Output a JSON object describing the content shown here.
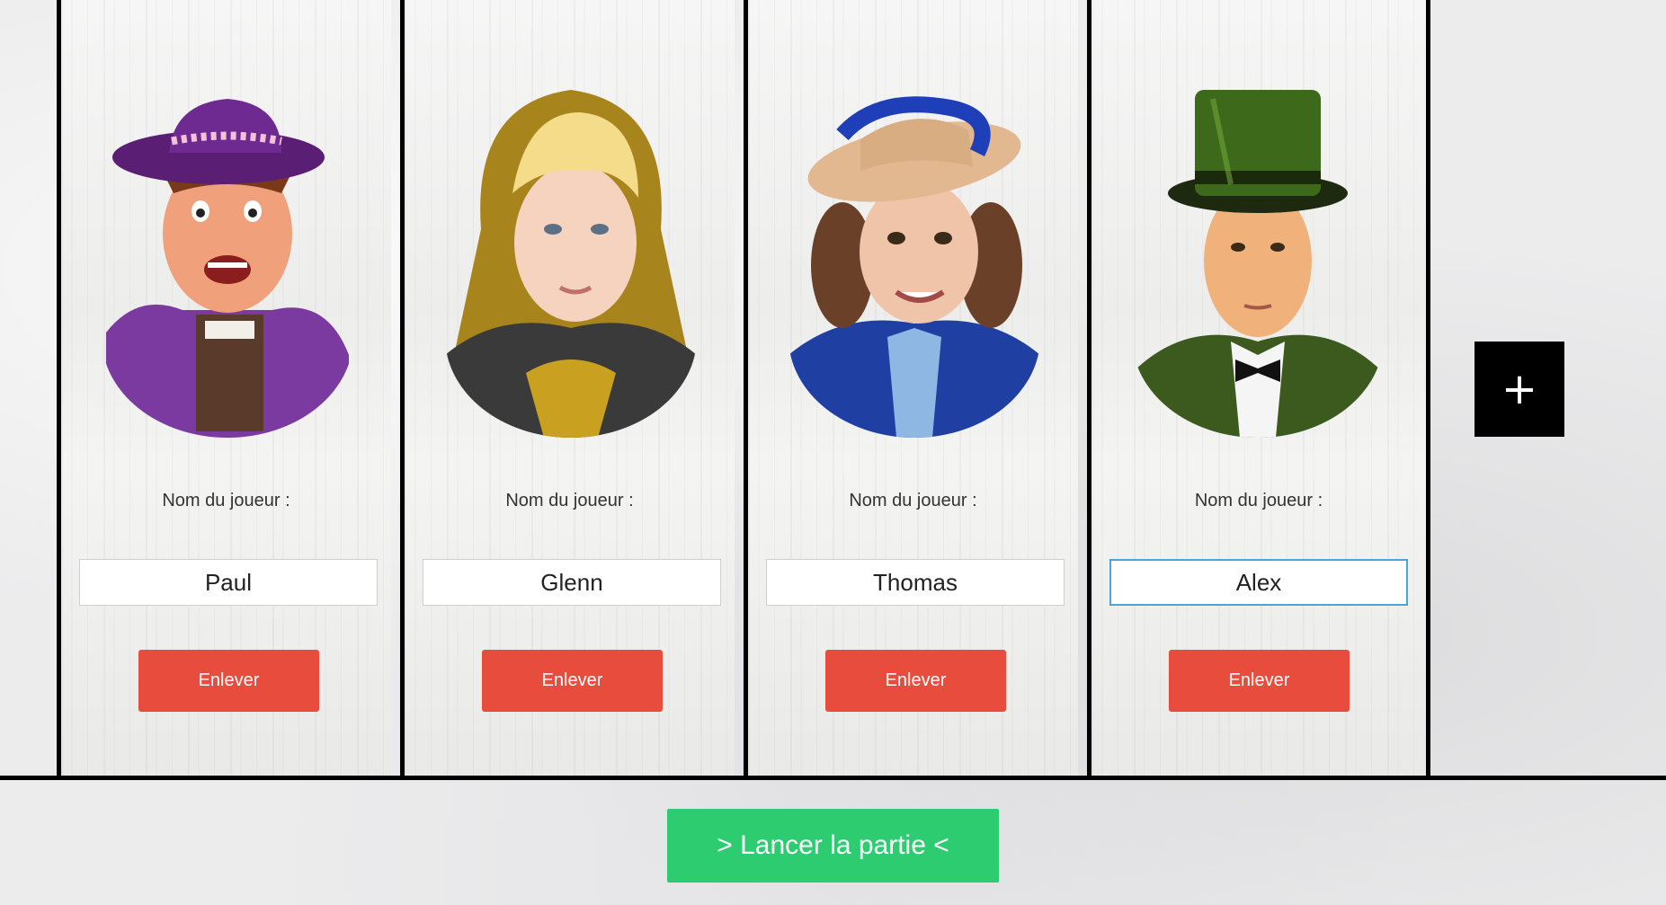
{
  "players": [
    {
      "character": "boy-purple-hat",
      "name_label": "Nom du joueur :",
      "name_value": "Paul",
      "remove_label": "Enlever"
    },
    {
      "character": "woman-yellow-hood",
      "name_label": "Nom du joueur :",
      "name_value": "Glenn",
      "remove_label": "Enlever"
    },
    {
      "character": "girl-blue-bonnet",
      "name_label": "Nom du joueur :",
      "name_value": "Thomas",
      "remove_label": "Enlever"
    },
    {
      "character": "man-green-top-hat",
      "name_label": "Nom du joueur :",
      "name_value": "Alex",
      "remove_label": "Enlever"
    }
  ],
  "add_button": {
    "label": "+"
  },
  "launch_button": {
    "label": "> Lancer la partie <"
  },
  "colors": {
    "remove": "#e74c3c",
    "launch": "#2ecc71",
    "add": "#000000",
    "focus": "#4ba5d8"
  }
}
